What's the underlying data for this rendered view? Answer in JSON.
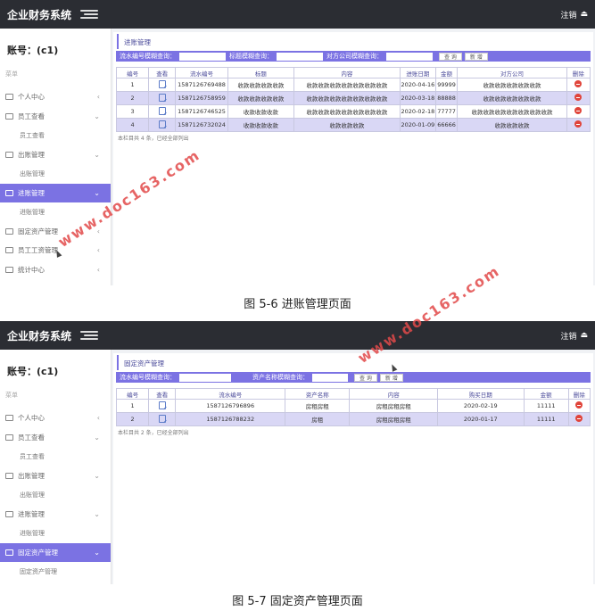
{
  "watermark": "www.doc163.com",
  "screens": [
    {
      "app": {
        "title": "企业财务系统",
        "logout": "注销"
      },
      "account": "账号：(c1)",
      "menu_title": "菜单",
      "menu": [
        {
          "label": "个人中心",
          "type": "parent",
          "chev": "‹"
        },
        {
          "label": "员工查看",
          "type": "parent",
          "chev": "⌄"
        },
        {
          "label": "员工查看",
          "type": "sub"
        },
        {
          "label": "出账管理",
          "type": "parent",
          "chev": "⌄"
        },
        {
          "label": "出账管理",
          "type": "sub"
        },
        {
          "label": "进账管理",
          "type": "active",
          "chev": "⌄"
        },
        {
          "label": "进账管理",
          "type": "sub"
        },
        {
          "label": "固定资产管理",
          "type": "parent",
          "chev": "‹"
        },
        {
          "label": "员工工资管理",
          "type": "parent",
          "chev": "‹"
        },
        {
          "label": "统计中心",
          "type": "parent",
          "chev": "‹"
        }
      ],
      "page_title": "进账管理",
      "search": {
        "label1": "流水编号模糊查询：",
        "label2": "标题模糊查询：",
        "label3": "对方公司模糊查询：",
        "query_btn": "查 询",
        "add_btn": "新 增"
      },
      "table": {
        "columns": [
          "编号",
          "查看",
          "流水编号",
          "标题",
          "内容",
          "进账日期",
          "金额",
          "对方公司",
          "删除"
        ],
        "rows": [
          [
            "1",
            "",
            "1587126769488",
            "收款收款收款收款",
            "收款收款收款收款收款收款收款",
            "2020-04-16",
            "99999",
            "收款收款收款收款收款",
            ""
          ],
          [
            "2",
            "",
            "1587126758959",
            "收款收款收款收款",
            "收款收款收款收款收款收款收款",
            "2020-03-18",
            "88888",
            "收款收款收款收款收款",
            ""
          ],
          [
            "3",
            "",
            "1587126746525",
            "收款收款收款",
            "收款收款收款收款收款收款收款",
            "2020-02-18",
            "77777",
            "收款收款收款收款收款收款收款",
            ""
          ],
          [
            "4",
            "",
            "1587126732024",
            "收款收款收款",
            "收款收款收款",
            "2020-01-09",
            "66666",
            "收款收款收款",
            ""
          ]
        ]
      },
      "footnote": "本栏目共 4 条，已经全部列出",
      "caption": "图 5-6 进账管理页面"
    },
    {
      "app": {
        "title": "企业财务系统",
        "logout": "注销"
      },
      "account": "账号：(c1)",
      "menu_title": "菜单",
      "menu": [
        {
          "label": "个人中心",
          "type": "parent",
          "chev": "‹"
        },
        {
          "label": "员工查看",
          "type": "parent",
          "chev": "⌄"
        },
        {
          "label": "员工查看",
          "type": "sub"
        },
        {
          "label": "出账管理",
          "type": "parent",
          "chev": "⌄"
        },
        {
          "label": "出账管理",
          "type": "sub"
        },
        {
          "label": "进账管理",
          "type": "parent",
          "chev": "⌄"
        },
        {
          "label": "进账管理",
          "type": "sub"
        },
        {
          "label": "固定资产管理",
          "type": "active",
          "chev": "⌄"
        },
        {
          "label": "固定资产管理",
          "type": "sub"
        }
      ],
      "page_title": "固定资产管理",
      "search": {
        "label1": "流水编号模糊查询：",
        "label2": "资产名称模糊查询：",
        "query_btn": "查 询",
        "add_btn": "新 增"
      },
      "table": {
        "columns": [
          "编号",
          "查看",
          "流水编号",
          "资产名称",
          "内容",
          "购买日期",
          "金额",
          "删除"
        ],
        "rows": [
          [
            "1",
            "",
            "1587126796896",
            "房租房租",
            "房租房租房租",
            "2020-02-19",
            "11111",
            ""
          ],
          [
            "2",
            "",
            "1587126788232",
            "房租",
            "房租房租房租",
            "2020-01-17",
            "11111",
            ""
          ]
        ]
      },
      "footnote": "本栏目共 2 条，已经全部列出",
      "caption": "图 5-7 固定资产管理页面"
    }
  ]
}
